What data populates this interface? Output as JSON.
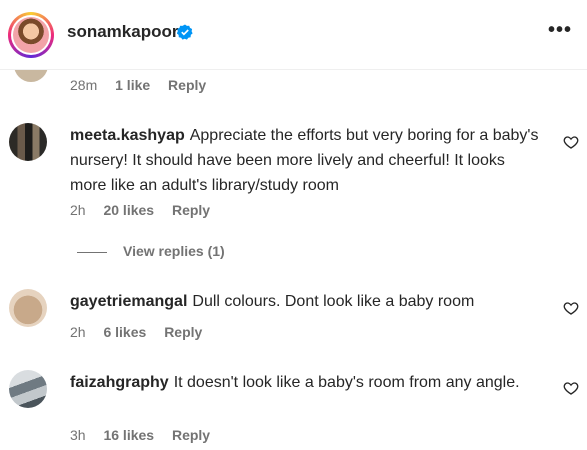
{
  "header": {
    "username": "sonamkapoor"
  },
  "partial_comment": {
    "time": "28m",
    "likes": "1 like",
    "reply": "Reply"
  },
  "comments": [
    {
      "user": "meeta.kashyap",
      "text": "Appreciate the efforts but very boring for a baby's nursery! It should have been more lively and cheerful! It looks more like an adult's library/study room",
      "time": "2h",
      "likes": "20 likes",
      "reply": "Reply"
    },
    {
      "user": "gayetriemangal",
      "text": "Dull colours. Dont look like a baby room",
      "time": "2h",
      "likes": "6 likes",
      "reply": "Reply"
    },
    {
      "user": "faizahgraphy",
      "text": "It doesn't look like a baby's room from any angle.",
      "time": "3h",
      "likes": "16 likes",
      "reply": "Reply"
    }
  ],
  "view_replies": "View replies (1)"
}
